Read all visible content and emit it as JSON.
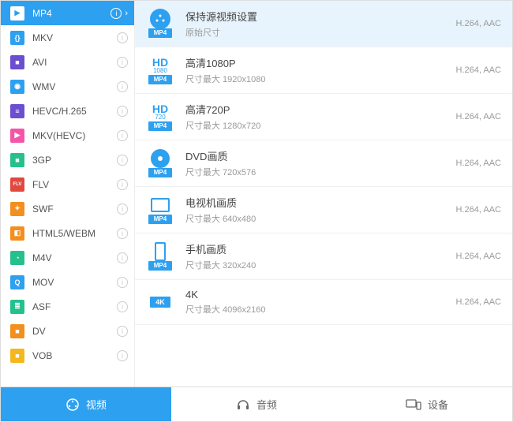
{
  "sidebar": {
    "items": [
      {
        "label": "MP4",
        "icon": "▶",
        "color": "#2da0f0",
        "active": true,
        "chev": true
      },
      {
        "label": "MKV",
        "icon": "{}",
        "color": "#2da0f0"
      },
      {
        "label": "AVI",
        "icon": "■",
        "color": "#6a4fd0"
      },
      {
        "label": "WMV",
        "icon": "◉",
        "color": "#2da0f0"
      },
      {
        "label": "HEVC/H.265",
        "icon": "≡",
        "color": "#6a4fd0"
      },
      {
        "label": "MKV(HEVC)",
        "icon": "▶",
        "color": "#f555a8"
      },
      {
        "label": "3GP",
        "icon": "■",
        "color": "#26c08e"
      },
      {
        "label": "FLV",
        "icon": "FLV",
        "color": "#e0493e"
      },
      {
        "label": "SWF",
        "icon": "✦",
        "color": "#f28f1e"
      },
      {
        "label": "HTML5/WEBM",
        "icon": "◧",
        "color": "#f28f1e"
      },
      {
        "label": "M4V",
        "icon": "◔",
        "color": "#26c08e"
      },
      {
        "label": "MOV",
        "icon": "Q",
        "color": "#2da0f0"
      },
      {
        "label": "ASF",
        "icon": "≣",
        "color": "#26c08e"
      },
      {
        "label": "DV",
        "icon": "■",
        "color": "#f28f1e"
      },
      {
        "label": "VOB",
        "icon": "■",
        "color": "#f4b81e"
      }
    ]
  },
  "presets": [
    {
      "title": "保持源视频设置",
      "sub": "原始尺寸",
      "codec": "H.264, AAC",
      "icontype": "reel",
      "badge": "MP4",
      "selected": true
    },
    {
      "title": "高清1080P",
      "sub": "尺寸最大 1920x1080",
      "codec": "H.264, AAC",
      "icontype": "hd",
      "hd": "HD",
      "hdsub": "1080",
      "badge": "MP4"
    },
    {
      "title": "高清720P",
      "sub": "尺寸最大 1280x720",
      "codec": "H.264, AAC",
      "icontype": "hd",
      "hd": "HD",
      "hdsub": "720",
      "badge": "MP4"
    },
    {
      "title": "DVD画质",
      "sub": "尺寸最大 720x576",
      "codec": "H.264, AAC",
      "icontype": "disc",
      "badge": "MP4"
    },
    {
      "title": "电视机画质",
      "sub": "尺寸最大 640x480",
      "codec": "H.264, AAC",
      "icontype": "tv",
      "badge": "MP4"
    },
    {
      "title": "手机画质",
      "sub": "尺寸最大 320x240",
      "codec": "H.264, AAC",
      "icontype": "phone",
      "badge": "MP4"
    },
    {
      "title": "4K",
      "sub": "尺寸最大 4096x2160",
      "codec": "H.264, AAC",
      "icontype": "4k",
      "badge": "4K"
    }
  ],
  "tabs": {
    "video": "视频",
    "audio": "音频",
    "device": "设备"
  }
}
